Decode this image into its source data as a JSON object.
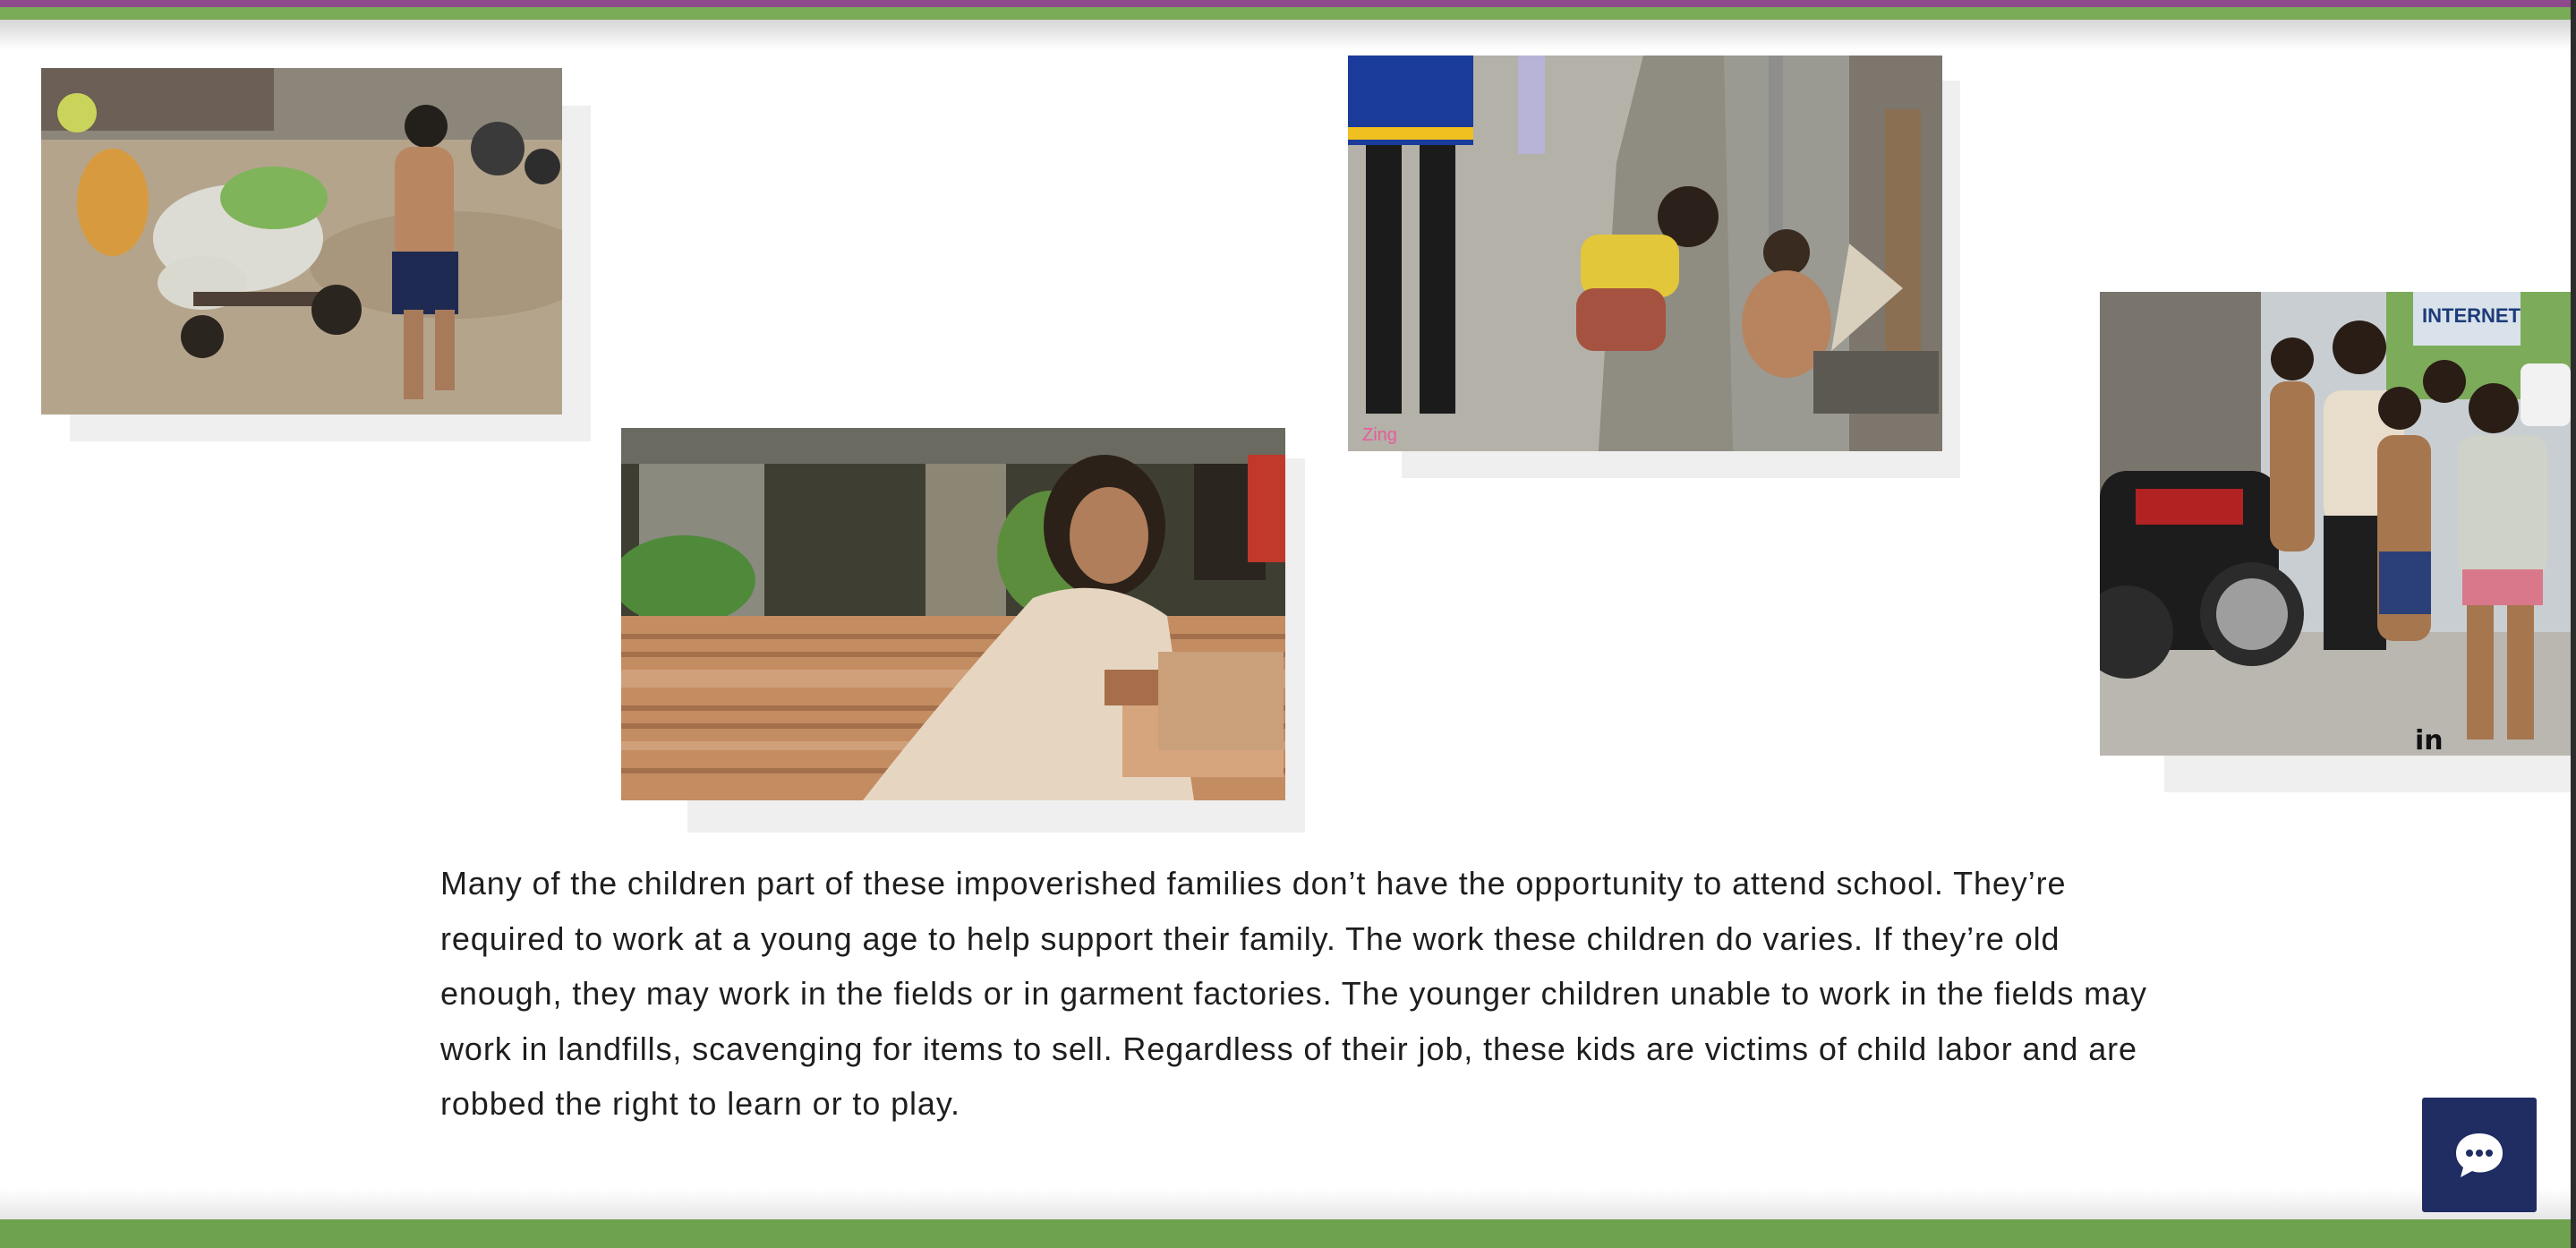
{
  "page": {
    "paragraph": "Many of the children part of these impoverished families don’t have the opportunity to attend school. They’re required to work at a young age to help support their family. The work these children do varies. If they’re old enough, they may work in the fields or in garment factories. The younger children unable to work in the fields may work in landfills, scavenging for items to sell. Regardless of their job, these kids are victims of child labor and are robbed the right to learn or to play."
  },
  "photos": {
    "cart": {
      "subject": "boy pulling a cart loaded with sacks on a muddy road"
    },
    "bricks": {
      "subject": "girl stacking bricks in a brickyard"
    },
    "street": {
      "subject": "children crouching on a city sidewalk",
      "watermark": "Zing"
    },
    "group": {
      "subject": "group of children smiling next to a motorbike",
      "sign": "INTERNET"
    }
  },
  "social": {
    "linkedin_label": "in"
  },
  "chat": {
    "icon": "chat-bubble-icon"
  },
  "colors": {
    "top_stripe_purple": "#8e4a8c",
    "top_stripe_green": "#7aab56",
    "bottom_stripe": "#6fa24e",
    "chat_background": "#1f2d63",
    "text": "#1e1e1e"
  }
}
